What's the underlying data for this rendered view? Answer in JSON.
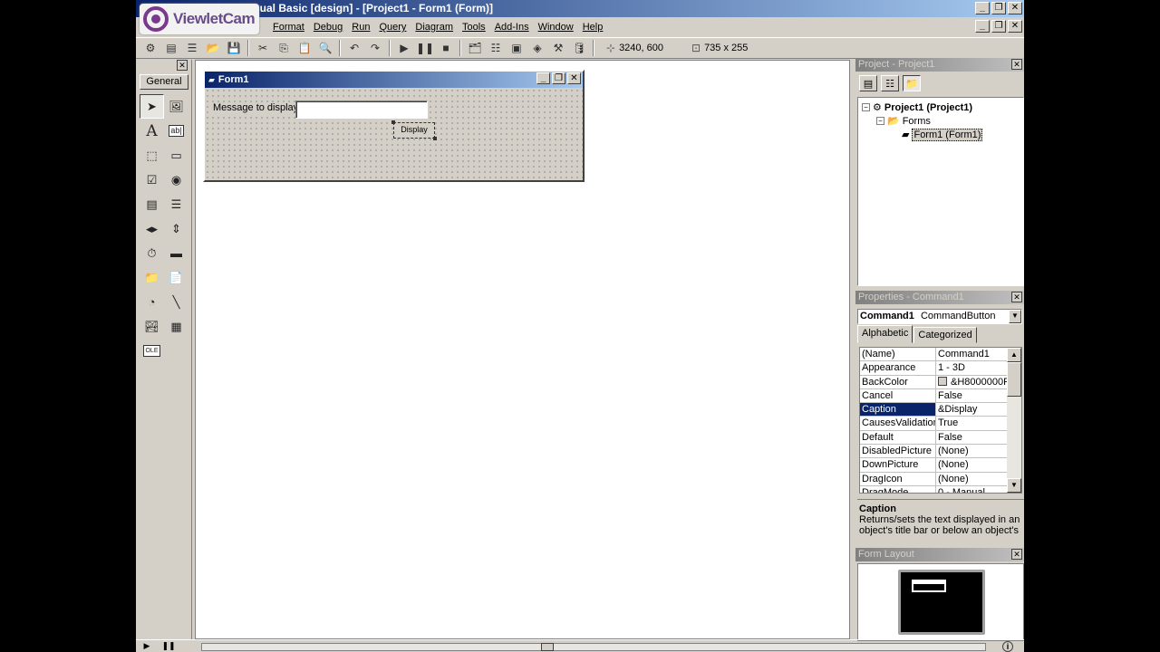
{
  "window": {
    "title": "...sual Basic [design] - [Project1 - Form1 (Form)]",
    "minimize": "_",
    "restore": "❐",
    "close": "✕"
  },
  "watermark": {
    "name": "ViewletCam"
  },
  "menu": [
    "Format",
    "Debug",
    "Run",
    "Query",
    "Diagram",
    "Tools",
    "Add-Ins",
    "Window",
    "Help"
  ],
  "toolbar": {
    "position": "3240, 600",
    "size": "735 x 255"
  },
  "toolbox": {
    "tab": "General",
    "close": "✕"
  },
  "form": {
    "title": "Form1",
    "label": "Message to display",
    "button_caption": "Display"
  },
  "project": {
    "title": "Project - Project1",
    "close": "✕",
    "tree": {
      "root": "Project1 (Project1)",
      "folder": "Forms",
      "item": "Form1 (Form1)"
    }
  },
  "properties": {
    "title": "Properties - Command1",
    "close": "✕",
    "object": "Command1",
    "object_type": "CommandButton",
    "tabs": [
      "Alphabetic",
      "Categorized"
    ],
    "rows": [
      {
        "name": "(Name)",
        "value": "Command1"
      },
      {
        "name": "Appearance",
        "value": "1 - 3D"
      },
      {
        "name": "BackColor",
        "value": "&H8000000F"
      },
      {
        "name": "Cancel",
        "value": "False"
      },
      {
        "name": "Caption",
        "value": "&Display"
      },
      {
        "name": "CausesValidation",
        "value": "True"
      },
      {
        "name": "Default",
        "value": "False"
      },
      {
        "name": "DisabledPicture",
        "value": "(None)"
      },
      {
        "name": "DownPicture",
        "value": "(None)"
      },
      {
        "name": "DragIcon",
        "value": "(None)"
      },
      {
        "name": "DragMode",
        "value": "0 - Manual"
      }
    ],
    "selected_row": 4,
    "desc_title": "Caption",
    "desc_text": "Returns/sets the text displayed in an object's title bar or below an object's"
  },
  "form_layout": {
    "title": "Form Layout",
    "close": "✕"
  },
  "colors": {
    "active_title": "#0a246a",
    "chrome": "#d4d0c8"
  }
}
